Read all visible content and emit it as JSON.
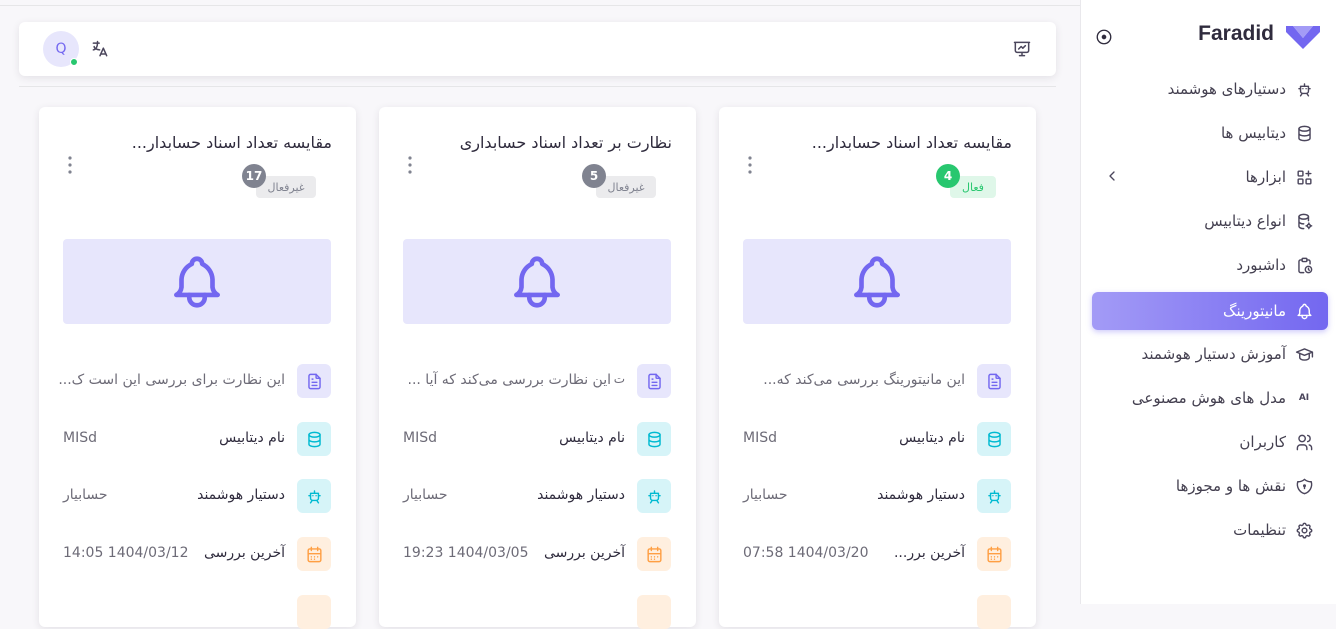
{
  "brand": {
    "name": "Faradid"
  },
  "sidebar": {
    "items": [
      {
        "label": "دستیارهای هوشمند",
        "icon": "robot-icon"
      },
      {
        "label": "دیتابیس ها",
        "icon": "database-icon"
      },
      {
        "label": "ابزارها",
        "icon": "apps-plus-icon"
      },
      {
        "label": "انواع دیتابیس",
        "icon": "database-cog-icon"
      },
      {
        "label": "داشبورد",
        "icon": "clipboard-clock-icon"
      },
      {
        "label": "مانیتورینگ",
        "icon": "bell-icon"
      },
      {
        "label": "آموزش دستیار هوشمند",
        "icon": "graduation-cap-icon"
      },
      {
        "label": "مدل های هوش مصنوعی",
        "icon": "ai-icon",
        "icon_text": "AI"
      },
      {
        "label": "کاربران",
        "icon": "users-icon"
      },
      {
        "label": "نقش ها و مجوزها",
        "icon": "shield-icon"
      },
      {
        "label": "تنظیمات",
        "icon": "settings-icon"
      }
    ],
    "active_index": 5
  },
  "navbar": {
    "avatar_letter": "Q"
  },
  "labels": {
    "database": "نام دیتابیس",
    "assistant": "دستیار هوشمند",
    "last_check": "آخرین بررسی",
    "last_check_short": "آخرین برر..."
  },
  "cards": [
    {
      "title": "مقایسه تعداد اسناد حسابدار...",
      "status": "فعال",
      "count": "4",
      "description": "این مانیتورینگ بررسی می‌کند که...",
      "description_mark": "",
      "database": "MISd",
      "assistant": "حسابیار",
      "last_check": "1404/03/20 07:58"
    },
    {
      "title": "نظارت بر تعداد اسناد حسابداری",
      "status": "غیرفعال",
      "count": "5",
      "description": "این نظارت بررسی می‌کند که آیا ...",
      "description_mark": "ت",
      "database": "MISd",
      "assistant": "حسابیار",
      "last_check": "1404/03/05 19:23"
    },
    {
      "title": "مقایسه تعداد اسناد حسابدار...",
      "status": "غیرفعال",
      "count": "17",
      "description": "این نظارت برای بررسی این است ک...",
      "description_mark": "",
      "database": "MISd",
      "assistant": "حسابیار",
      "last_check": "1404/03/12 14:05"
    }
  ],
  "colors": {
    "accent": "#7367f0",
    "success": "#28c76f",
    "info": "#00bad1",
    "warning": "#ff9f43",
    "secondary": "#808390"
  }
}
